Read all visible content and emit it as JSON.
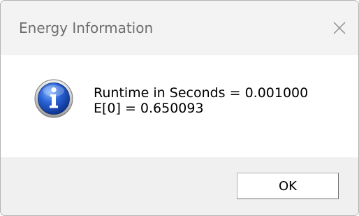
{
  "window": {
    "title": "Energy Information",
    "close_icon": "close-icon"
  },
  "message": {
    "icon": "info-icon",
    "lines": [
      "Runtime in Seconds = 0.001000",
      "E[0] = 0.650093"
    ]
  },
  "footer": {
    "ok_label": "OK"
  }
}
